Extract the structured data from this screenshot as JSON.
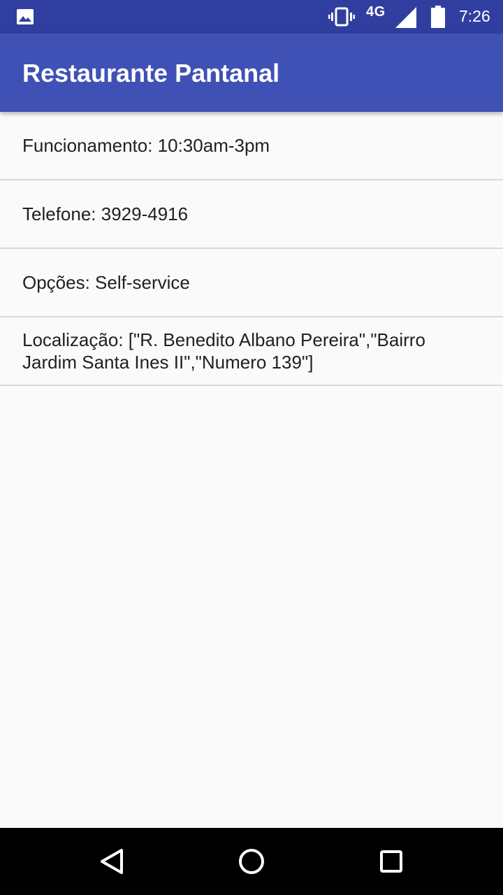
{
  "status_bar": {
    "network": "4G",
    "time": "7:26",
    "icons": [
      "image-notification-icon",
      "vibrate-icon",
      "signal-icon",
      "battery-icon"
    ]
  },
  "app_bar": {
    "title": "Restaurante Pantanal",
    "color": "#3f51b5"
  },
  "details": {
    "items": [
      {
        "text": "Funcionamento: 10:30am-3pm"
      },
      {
        "text": "Telefone: 3929-4916"
      },
      {
        "text": "Opções: Self-service"
      },
      {
        "text": "Localização: [\"R. Benedito Albano Pereira\",\"Bairro Jardim Santa Ines II\",\"Numero 139\"]"
      }
    ]
  },
  "nav_bar": {
    "icons": [
      "back-icon",
      "home-icon",
      "recents-icon"
    ]
  }
}
